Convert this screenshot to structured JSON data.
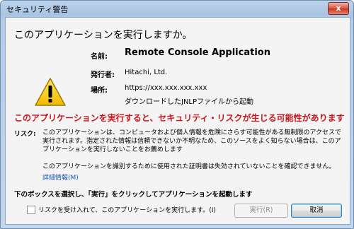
{
  "window": {
    "title": "セキュリティ警告",
    "close_label": "x"
  },
  "dialog": {
    "heading": "このアプリケーションを実行しますか。",
    "name_label": "名前:",
    "name_value": "Remote Console Application",
    "publisher_label": "発行者:",
    "publisher_value": "Hitachi, Ltd.",
    "location_label": "場所:",
    "location_value": "https://xxx.xxx.xxx.xxx",
    "location_note": "ダウンロードしたJNLPファイルから起動",
    "risk_warning": "このアプリケーションを実行すると、セキュリティ・リスクが生じる可能性があります",
    "risk_label": "リスク:",
    "risk_text": "このアプリケーションは、コンピュータおよび個人情報を危険にさらす可能性がある無制限のアクセスで実行されます。指定された情報は信頼できないか不明なため、このソースをよく知らない場合は、このアプリケーションを実行しないことをお薦めします",
    "cert_text": "このアプリケーションを識別するために使用された証明書は失効されていないことを確認できません。",
    "more_info": "詳細情報(M)",
    "instruction": "下のボックスを選択し、「実行」をクリックしてアプリケーションを起動します",
    "checkbox_label": "リスクを受け入れて、このアプリケーションを実行します。(I)",
    "run_button": "実行(R)",
    "cancel_button": "取消"
  },
  "colors": {
    "warning_red": "#c7161c",
    "link_blue": "#1a56b5",
    "warning_yellow": "#f7d21a"
  },
  "icons": {
    "warning": "warning-triangle-icon"
  }
}
